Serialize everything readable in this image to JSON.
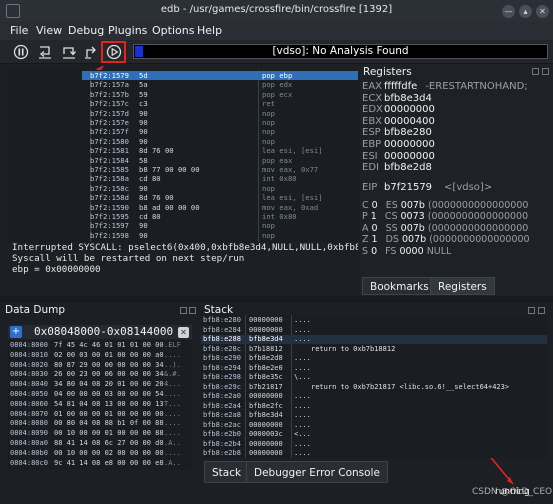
{
  "window": {
    "title": "edb - /usr/games/crossfire/bin/crossfire [1392]"
  },
  "menu": [
    "File",
    "View",
    "Debug",
    "Plugins",
    "Options",
    "Help"
  ],
  "toolbar": {
    "status_text": "[vdso]: No Analysis Found"
  },
  "disassembly": {
    "rows": [
      {
        "addr": "b7f2:1579",
        "bytes": "5d",
        "ins": "pop ebp",
        "selected": true
      },
      {
        "addr": "b7f2:157a",
        "bytes": "5a",
        "ins": "pop edx"
      },
      {
        "addr": "b7f2:157b",
        "bytes": "59",
        "ins": "pop ecx"
      },
      {
        "addr": "b7f2:157c",
        "bytes": "c3",
        "ins": "ret"
      },
      {
        "addr": "b7f2:157d",
        "bytes": "90",
        "ins": "nop"
      },
      {
        "addr": "b7f2:157e",
        "bytes": "90",
        "ins": "nop"
      },
      {
        "addr": "b7f2:157f",
        "bytes": "90",
        "ins": "nop"
      },
      {
        "addr": "b7f2:1580",
        "bytes": "90",
        "ins": "nop"
      },
      {
        "addr": "b7f2:1581",
        "bytes": "8d 76 00",
        "ins": "lea esi, [esi]"
      },
      {
        "addr": "b7f2:1584",
        "bytes": "58",
        "ins": "pop eax"
      },
      {
        "addr": "b7f2:1585",
        "bytes": "b8 77 00 00 00",
        "ins": "mov eax, 0x77"
      },
      {
        "addr": "b7f2:158a",
        "bytes": "cd 80",
        "ins": "int 0x80"
      },
      {
        "addr": "b7f2:158c",
        "bytes": "90",
        "ins": "nop"
      },
      {
        "addr": "b7f2:158d",
        "bytes": "8d 76 00",
        "ins": "lea esi, [esi]"
      },
      {
        "addr": "b7f2:1590",
        "bytes": "b8 ad 00 00 00",
        "ins": "mov eax, 0xad"
      },
      {
        "addr": "b7f2:1595",
        "bytes": "cd 80",
        "ins": "int 0x80"
      },
      {
        "addr": "b7f2:1597",
        "bytes": "90",
        "ins": "nop"
      },
      {
        "addr": "b7f2:1598",
        "bytes": "90",
        "ins": "nop"
      }
    ],
    "console": [
      "Interrupted SYSCALL: pselect6(0x400,0xbfb8e3d4,NULL,NULL,0xbfb8e",
      "Syscall will be restarted on next step/run",
      "ebp = 0x00000000"
    ]
  },
  "registers": {
    "title": "Registers",
    "gprs": [
      {
        "name": "EAX",
        "value": "fffffdfe",
        "comment": "-ERESTARTNOHAND;"
      },
      {
        "name": "ECX",
        "value": "bfb8e3d4",
        "comment": ""
      },
      {
        "name": "EDX",
        "value": "00000000",
        "comment": ""
      },
      {
        "name": "EBX",
        "value": "00000400",
        "comment": ""
      },
      {
        "name": "ESP",
        "value": "bfb8e280",
        "comment": ""
      },
      {
        "name": "EBP",
        "value": "00000000",
        "comment": ""
      },
      {
        "name": "ESI",
        "value": "00000000",
        "comment": ""
      },
      {
        "name": "EDI",
        "value": "bfb8e2d8",
        "comment": ""
      }
    ],
    "eip": {
      "name": "EIP",
      "value": "b7f21579",
      "comment": "<[vdso]>"
    },
    "flags": [
      {
        "f": "C",
        "fv": "0",
        "seg": "ES",
        "sv": "007b",
        "base": "(0000000000000000"
      },
      {
        "f": "P",
        "fv": "1",
        "seg": "CS",
        "sv": "0073",
        "base": "(0000000000000000"
      },
      {
        "f": "A",
        "fv": "0",
        "seg": "SS",
        "sv": "007b",
        "base": "(0000000000000000"
      },
      {
        "f": "Z",
        "fv": "1",
        "seg": "DS",
        "sv": "007b",
        "base": "(0000000000000000"
      },
      {
        "f": "S",
        "fv": "0",
        "seg": "FS",
        "sv": "0000",
        "base": "NULL"
      }
    ],
    "tabs": [
      "Bookmarks",
      "Registers"
    ]
  },
  "data_dump": {
    "title": "Data Dump",
    "range": "0x08048000-0x08144000",
    "rows": [
      {
        "a": "0804:8000",
        "h": "7f 45 4c 46 01 01 01 00 00",
        "s": ".ELF"
      },
      {
        "a": "0804:8010",
        "h": "02 00 03 00 01 00 00 00 a0",
        "s": "...."
      },
      {
        "a": "0804:8020",
        "h": "80 87 29 00 00 00 00 00 34",
        "s": "..)."
      },
      {
        "a": "0804:8030",
        "h": "26 00 23 00 06 00 00 00 34",
        "s": "&.#."
      },
      {
        "a": "0804:8040",
        "h": "34 80 04 08 20 01 00 00 20",
        "s": "4..."
      },
      {
        "a": "0804:8050",
        "h": "04 00 00 00 03 00 00 00 54",
        "s": "...."
      },
      {
        "a": "0804:8060",
        "h": "54 81 04 08 13 00 00 00 13",
        "s": "T..."
      },
      {
        "a": "0804:8070",
        "h": "01 00 00 00 01 00 00 00 00",
        "s": "...."
      },
      {
        "a": "0804:8080",
        "h": "00 80 04 08 88 b1 0f 00 88",
        "s": "...."
      },
      {
        "a": "0804:8090",
        "h": "00 10 00 00 01 00 00 00 88",
        "s": "...."
      },
      {
        "a": "0804:80a0",
        "h": "88 41 14 08 6c 27 00 00 d0",
        "s": ".A.."
      },
      {
        "a": "0804:80b0",
        "h": "00 10 00 00 02 00 00 00 00",
        "s": "...."
      },
      {
        "a": "0804:80c0",
        "h": "9c 41 14 08 e8 00 00 00 e8",
        "s": ".A.."
      }
    ]
  },
  "stack": {
    "title": "Stack",
    "rows": [
      {
        "a": "bfb8:e280",
        "v": "00000000",
        "c": "...."
      },
      {
        "a": "bfb8:e284",
        "v": "00000000",
        "c": "...."
      },
      {
        "a": "bfb8:e288",
        "v": "bfb8e3d4",
        "c": "....",
        "sel": true
      },
      {
        "a": "bfb8:e28c",
        "v": "b7b18812",
        "c": "return to 0xb7b18812"
      },
      {
        "a": "bfb8:e290",
        "v": "bfb8e2d8",
        "c": "...."
      },
      {
        "a": "bfb8:e294",
        "v": "bfb8e2e0",
        "c": "...."
      },
      {
        "a": "bfb8:e298",
        "v": "bfb8e35c",
        "c": "\\..."
      },
      {
        "a": "bfb8:e29c",
        "v": "b7b21817",
        "c": "return to 0xb7b21817 <libc.so.6!__select64+423>"
      },
      {
        "a": "bfb8:e2a0",
        "v": "00000000",
        "c": "...."
      },
      {
        "a": "bfb8:e2a4",
        "v": "bfb8e2fc",
        "c": "...."
      },
      {
        "a": "bfb8:e2a8",
        "v": "bfb8e3d4",
        "c": "...."
      },
      {
        "a": "bfb8:e2ac",
        "v": "00000000",
        "c": "...."
      },
      {
        "a": "bfb8:e2b0",
        "v": "0000003c",
        "c": "<..."
      },
      {
        "a": "bfb8:e2b4",
        "v": "00000000",
        "c": "...."
      },
      {
        "a": "bfb8:e2b8",
        "v": "00000000",
        "c": "...."
      }
    ],
    "tabs": [
      "Stack",
      "Debugger Error Console"
    ]
  },
  "status": {
    "state": "running",
    "watermark": "CSDN @OLD_CEO"
  },
  "colors": {
    "accent": "#2f6fb8",
    "highlight": "#e3231c"
  }
}
